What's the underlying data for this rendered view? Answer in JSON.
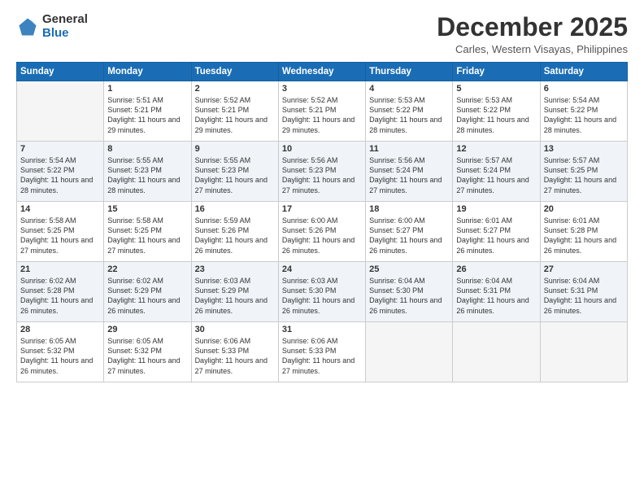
{
  "logo": {
    "general": "General",
    "blue": "Blue"
  },
  "title": "December 2025",
  "subtitle": "Carles, Western Visayas, Philippines",
  "days": [
    "Sunday",
    "Monday",
    "Tuesday",
    "Wednesday",
    "Thursday",
    "Friday",
    "Saturday"
  ],
  "weeks": [
    [
      {
        "day": "",
        "sunrise": "",
        "sunset": "",
        "daylight": ""
      },
      {
        "day": "1",
        "sunrise": "Sunrise: 5:51 AM",
        "sunset": "Sunset: 5:21 PM",
        "daylight": "Daylight: 11 hours and 29 minutes."
      },
      {
        "day": "2",
        "sunrise": "Sunrise: 5:52 AM",
        "sunset": "Sunset: 5:21 PM",
        "daylight": "Daylight: 11 hours and 29 minutes."
      },
      {
        "day": "3",
        "sunrise": "Sunrise: 5:52 AM",
        "sunset": "Sunset: 5:21 PM",
        "daylight": "Daylight: 11 hours and 29 minutes."
      },
      {
        "day": "4",
        "sunrise": "Sunrise: 5:53 AM",
        "sunset": "Sunset: 5:22 PM",
        "daylight": "Daylight: 11 hours and 28 minutes."
      },
      {
        "day": "5",
        "sunrise": "Sunrise: 5:53 AM",
        "sunset": "Sunset: 5:22 PM",
        "daylight": "Daylight: 11 hours and 28 minutes."
      },
      {
        "day": "6",
        "sunrise": "Sunrise: 5:54 AM",
        "sunset": "Sunset: 5:22 PM",
        "daylight": "Daylight: 11 hours and 28 minutes."
      }
    ],
    [
      {
        "day": "7",
        "sunrise": "Sunrise: 5:54 AM",
        "sunset": "Sunset: 5:22 PM",
        "daylight": "Daylight: 11 hours and 28 minutes."
      },
      {
        "day": "8",
        "sunrise": "Sunrise: 5:55 AM",
        "sunset": "Sunset: 5:23 PM",
        "daylight": "Daylight: 11 hours and 28 minutes."
      },
      {
        "day": "9",
        "sunrise": "Sunrise: 5:55 AM",
        "sunset": "Sunset: 5:23 PM",
        "daylight": "Daylight: 11 hours and 27 minutes."
      },
      {
        "day": "10",
        "sunrise": "Sunrise: 5:56 AM",
        "sunset": "Sunset: 5:23 PM",
        "daylight": "Daylight: 11 hours and 27 minutes."
      },
      {
        "day": "11",
        "sunrise": "Sunrise: 5:56 AM",
        "sunset": "Sunset: 5:24 PM",
        "daylight": "Daylight: 11 hours and 27 minutes."
      },
      {
        "day": "12",
        "sunrise": "Sunrise: 5:57 AM",
        "sunset": "Sunset: 5:24 PM",
        "daylight": "Daylight: 11 hours and 27 minutes."
      },
      {
        "day": "13",
        "sunrise": "Sunrise: 5:57 AM",
        "sunset": "Sunset: 5:25 PM",
        "daylight": "Daylight: 11 hours and 27 minutes."
      }
    ],
    [
      {
        "day": "14",
        "sunrise": "Sunrise: 5:58 AM",
        "sunset": "Sunset: 5:25 PM",
        "daylight": "Daylight: 11 hours and 27 minutes."
      },
      {
        "day": "15",
        "sunrise": "Sunrise: 5:58 AM",
        "sunset": "Sunset: 5:25 PM",
        "daylight": "Daylight: 11 hours and 27 minutes."
      },
      {
        "day": "16",
        "sunrise": "Sunrise: 5:59 AM",
        "sunset": "Sunset: 5:26 PM",
        "daylight": "Daylight: 11 hours and 26 minutes."
      },
      {
        "day": "17",
        "sunrise": "Sunrise: 6:00 AM",
        "sunset": "Sunset: 5:26 PM",
        "daylight": "Daylight: 11 hours and 26 minutes."
      },
      {
        "day": "18",
        "sunrise": "Sunrise: 6:00 AM",
        "sunset": "Sunset: 5:27 PM",
        "daylight": "Daylight: 11 hours and 26 minutes."
      },
      {
        "day": "19",
        "sunrise": "Sunrise: 6:01 AM",
        "sunset": "Sunset: 5:27 PM",
        "daylight": "Daylight: 11 hours and 26 minutes."
      },
      {
        "day": "20",
        "sunrise": "Sunrise: 6:01 AM",
        "sunset": "Sunset: 5:28 PM",
        "daylight": "Daylight: 11 hours and 26 minutes."
      }
    ],
    [
      {
        "day": "21",
        "sunrise": "Sunrise: 6:02 AM",
        "sunset": "Sunset: 5:28 PM",
        "daylight": "Daylight: 11 hours and 26 minutes."
      },
      {
        "day": "22",
        "sunrise": "Sunrise: 6:02 AM",
        "sunset": "Sunset: 5:29 PM",
        "daylight": "Daylight: 11 hours and 26 minutes."
      },
      {
        "day": "23",
        "sunrise": "Sunrise: 6:03 AM",
        "sunset": "Sunset: 5:29 PM",
        "daylight": "Daylight: 11 hours and 26 minutes."
      },
      {
        "day": "24",
        "sunrise": "Sunrise: 6:03 AM",
        "sunset": "Sunset: 5:30 PM",
        "daylight": "Daylight: 11 hours and 26 minutes."
      },
      {
        "day": "25",
        "sunrise": "Sunrise: 6:04 AM",
        "sunset": "Sunset: 5:30 PM",
        "daylight": "Daylight: 11 hours and 26 minutes."
      },
      {
        "day": "26",
        "sunrise": "Sunrise: 6:04 AM",
        "sunset": "Sunset: 5:31 PM",
        "daylight": "Daylight: 11 hours and 26 minutes."
      },
      {
        "day": "27",
        "sunrise": "Sunrise: 6:04 AM",
        "sunset": "Sunset: 5:31 PM",
        "daylight": "Daylight: 11 hours and 26 minutes."
      }
    ],
    [
      {
        "day": "28",
        "sunrise": "Sunrise: 6:05 AM",
        "sunset": "Sunset: 5:32 PM",
        "daylight": "Daylight: 11 hours and 26 minutes."
      },
      {
        "day": "29",
        "sunrise": "Sunrise: 6:05 AM",
        "sunset": "Sunset: 5:32 PM",
        "daylight": "Daylight: 11 hours and 27 minutes."
      },
      {
        "day": "30",
        "sunrise": "Sunrise: 6:06 AM",
        "sunset": "Sunset: 5:33 PM",
        "daylight": "Daylight: 11 hours and 27 minutes."
      },
      {
        "day": "31",
        "sunrise": "Sunrise: 6:06 AM",
        "sunset": "Sunset: 5:33 PM",
        "daylight": "Daylight: 11 hours and 27 minutes."
      },
      {
        "day": "",
        "sunrise": "",
        "sunset": "",
        "daylight": ""
      },
      {
        "day": "",
        "sunrise": "",
        "sunset": "",
        "daylight": ""
      },
      {
        "day": "",
        "sunrise": "",
        "sunset": "",
        "daylight": ""
      }
    ]
  ]
}
